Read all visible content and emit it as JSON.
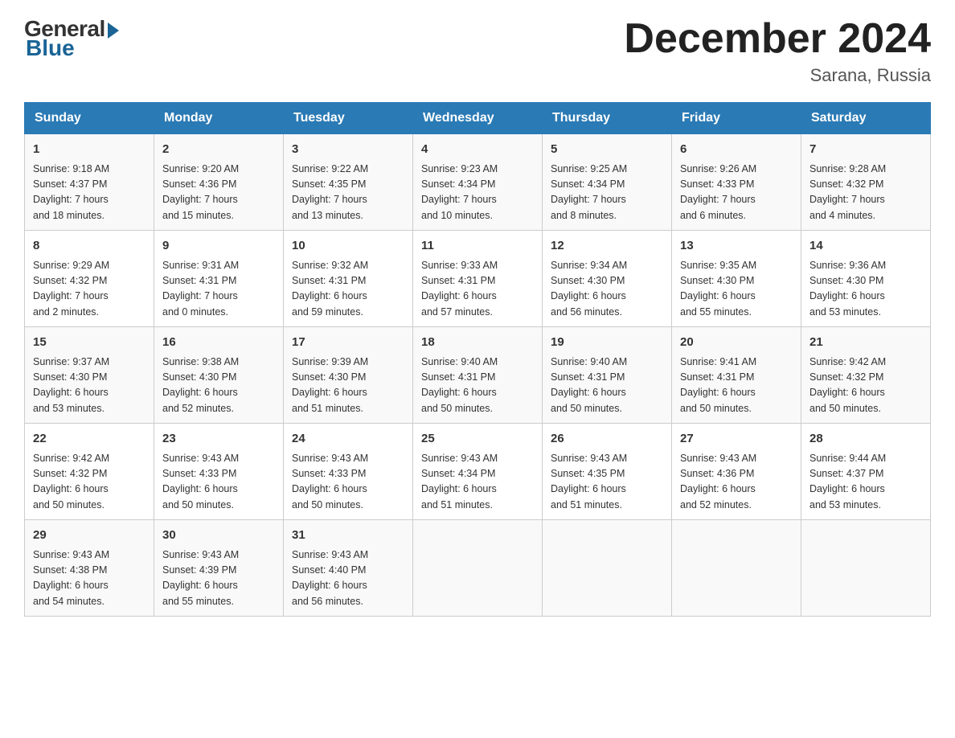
{
  "header": {
    "logo": {
      "general": "General",
      "blue": "Blue"
    },
    "title": "December 2024",
    "location": "Sarana, Russia"
  },
  "days_of_week": [
    "Sunday",
    "Monday",
    "Tuesday",
    "Wednesday",
    "Thursday",
    "Friday",
    "Saturday"
  ],
  "weeks": [
    [
      {
        "day": "1",
        "sunrise": "9:18 AM",
        "sunset": "4:37 PM",
        "daylight_h": "7",
        "daylight_m": "18"
      },
      {
        "day": "2",
        "sunrise": "9:20 AM",
        "sunset": "4:36 PM",
        "daylight_h": "7",
        "daylight_m": "15"
      },
      {
        "day": "3",
        "sunrise": "9:22 AM",
        "sunset": "4:35 PM",
        "daylight_h": "7",
        "daylight_m": "13"
      },
      {
        "day": "4",
        "sunrise": "9:23 AM",
        "sunset": "4:34 PM",
        "daylight_h": "7",
        "daylight_m": "10"
      },
      {
        "day": "5",
        "sunrise": "9:25 AM",
        "sunset": "4:34 PM",
        "daylight_h": "7",
        "daylight_m": "8"
      },
      {
        "day": "6",
        "sunrise": "9:26 AM",
        "sunset": "4:33 PM",
        "daylight_h": "7",
        "daylight_m": "6"
      },
      {
        "day": "7",
        "sunrise": "9:28 AM",
        "sunset": "4:32 PM",
        "daylight_h": "7",
        "daylight_m": "4"
      }
    ],
    [
      {
        "day": "8",
        "sunrise": "9:29 AM",
        "sunset": "4:32 PM",
        "daylight_h": "7",
        "daylight_m": "2"
      },
      {
        "day": "9",
        "sunrise": "9:31 AM",
        "sunset": "4:31 PM",
        "daylight_h": "7",
        "daylight_m": "0"
      },
      {
        "day": "10",
        "sunrise": "9:32 AM",
        "sunset": "4:31 PM",
        "daylight_h": "6",
        "daylight_m": "59"
      },
      {
        "day": "11",
        "sunrise": "9:33 AM",
        "sunset": "4:31 PM",
        "daylight_h": "6",
        "daylight_m": "57"
      },
      {
        "day": "12",
        "sunrise": "9:34 AM",
        "sunset": "4:30 PM",
        "daylight_h": "6",
        "daylight_m": "56"
      },
      {
        "day": "13",
        "sunrise": "9:35 AM",
        "sunset": "4:30 PM",
        "daylight_h": "6",
        "daylight_m": "55"
      },
      {
        "day": "14",
        "sunrise": "9:36 AM",
        "sunset": "4:30 PM",
        "daylight_h": "6",
        "daylight_m": "53"
      }
    ],
    [
      {
        "day": "15",
        "sunrise": "9:37 AM",
        "sunset": "4:30 PM",
        "daylight_h": "6",
        "daylight_m": "53"
      },
      {
        "day": "16",
        "sunrise": "9:38 AM",
        "sunset": "4:30 PM",
        "daylight_h": "6",
        "daylight_m": "52"
      },
      {
        "day": "17",
        "sunrise": "9:39 AM",
        "sunset": "4:30 PM",
        "daylight_h": "6",
        "daylight_m": "51"
      },
      {
        "day": "18",
        "sunrise": "9:40 AM",
        "sunset": "4:31 PM",
        "daylight_h": "6",
        "daylight_m": "50"
      },
      {
        "day": "19",
        "sunrise": "9:40 AM",
        "sunset": "4:31 PM",
        "daylight_h": "6",
        "daylight_m": "50"
      },
      {
        "day": "20",
        "sunrise": "9:41 AM",
        "sunset": "4:31 PM",
        "daylight_h": "6",
        "daylight_m": "50"
      },
      {
        "day": "21",
        "sunrise": "9:42 AM",
        "sunset": "4:32 PM",
        "daylight_h": "6",
        "daylight_m": "50"
      }
    ],
    [
      {
        "day": "22",
        "sunrise": "9:42 AM",
        "sunset": "4:32 PM",
        "daylight_h": "6",
        "daylight_m": "50"
      },
      {
        "day": "23",
        "sunrise": "9:43 AM",
        "sunset": "4:33 PM",
        "daylight_h": "6",
        "daylight_m": "50"
      },
      {
        "day": "24",
        "sunrise": "9:43 AM",
        "sunset": "4:33 PM",
        "daylight_h": "6",
        "daylight_m": "50"
      },
      {
        "day": "25",
        "sunrise": "9:43 AM",
        "sunset": "4:34 PM",
        "daylight_h": "6",
        "daylight_m": "51"
      },
      {
        "day": "26",
        "sunrise": "9:43 AM",
        "sunset": "4:35 PM",
        "daylight_h": "6",
        "daylight_m": "51"
      },
      {
        "day": "27",
        "sunrise": "9:43 AM",
        "sunset": "4:36 PM",
        "daylight_h": "6",
        "daylight_m": "52"
      },
      {
        "day": "28",
        "sunrise": "9:44 AM",
        "sunset": "4:37 PM",
        "daylight_h": "6",
        "daylight_m": "53"
      }
    ],
    [
      {
        "day": "29",
        "sunrise": "9:43 AM",
        "sunset": "4:38 PM",
        "daylight_h": "6",
        "daylight_m": "54"
      },
      {
        "day": "30",
        "sunrise": "9:43 AM",
        "sunset": "4:39 PM",
        "daylight_h": "6",
        "daylight_m": "55"
      },
      {
        "day": "31",
        "sunrise": "9:43 AM",
        "sunset": "4:40 PM",
        "daylight_h": "6",
        "daylight_m": "56"
      },
      null,
      null,
      null,
      null
    ]
  ]
}
